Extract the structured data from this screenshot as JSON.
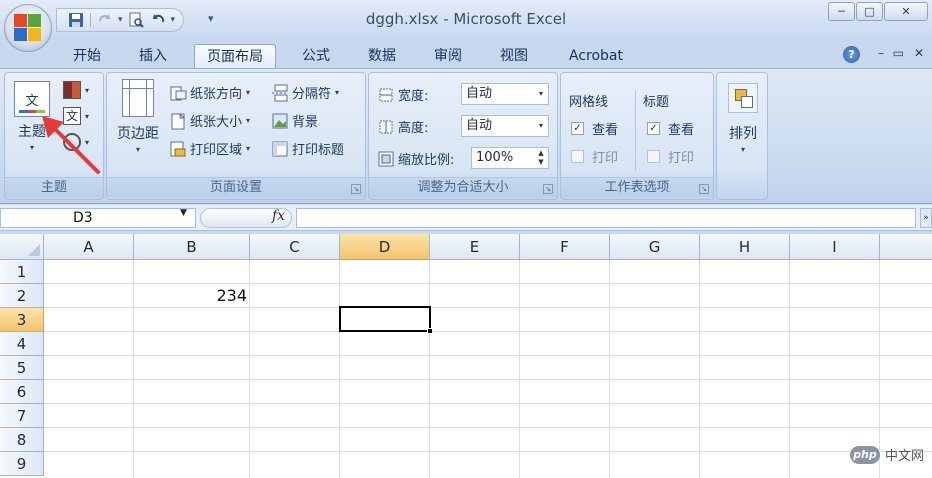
{
  "window": {
    "title": "dggh.xlsx - Microsoft Excel",
    "minimize": "─",
    "maximize": "□",
    "close": "✕"
  },
  "quick_access": {
    "save_icon": "save-icon",
    "undo_icon": "undo-icon",
    "print_preview_icon": "print-preview-icon",
    "redo_icon": "redo-icon"
  },
  "tabs": [
    "开始",
    "插入",
    "页面布局",
    "公式",
    "数据",
    "审阅",
    "视图",
    "Acrobat"
  ],
  "active_tab": "页面布局",
  "ribbon": {
    "theme_group": {
      "label": "主题",
      "theme_button": "主题",
      "theme_icon_text": "文",
      "fonts_icon_text": "文"
    },
    "page_setup_group": {
      "label": "页面设置",
      "margins": "页边距",
      "orientation": "纸张方向",
      "size": "纸张大小",
      "print_area": "打印区域",
      "breaks": "分隔符",
      "background": "背景",
      "print_titles": "打印标题"
    },
    "scale_group": {
      "label": "调整为合适大小",
      "width_label": "宽度:",
      "width_value": "自动",
      "height_label": "高度:",
      "height_value": "自动",
      "scale_label": "缩放比例:",
      "scale_value": "100%"
    },
    "sheet_options_group": {
      "label": "工作表选项",
      "gridlines_title": "网格线",
      "headings_title": "标题",
      "view": "查看",
      "print": "打印",
      "check_mark": "✓"
    },
    "arrange_group": {
      "label": "排列"
    }
  },
  "formula_bar": {
    "name_box": "D3",
    "fx": "fx",
    "formula": ""
  },
  "sheet": {
    "columns": [
      "A",
      "B",
      "C",
      "D",
      "E",
      "F",
      "G",
      "H",
      "I"
    ],
    "rows": [
      "1",
      "2",
      "3",
      "4",
      "5",
      "6",
      "7",
      "8",
      "9"
    ],
    "cells": {
      "B2": "234"
    },
    "active_cell": "D3"
  },
  "watermark": {
    "badge": "php",
    "text": "中文网"
  },
  "colors": {
    "ribbon_bg": "#c6d8ee",
    "active_header": "#f2c46c",
    "arrow": "#e43a3a"
  }
}
